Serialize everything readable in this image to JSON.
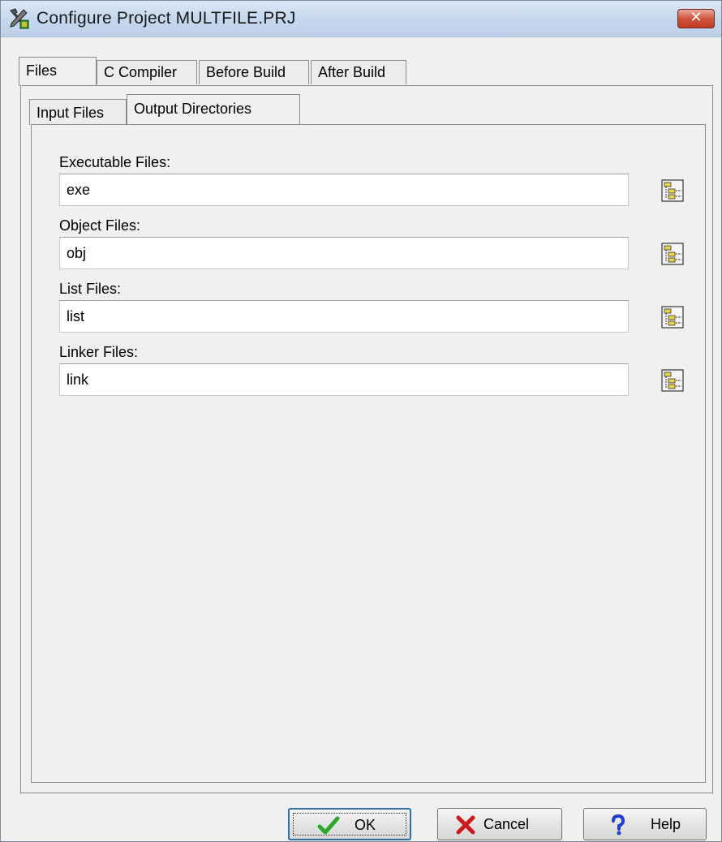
{
  "window": {
    "title": "Configure Project MULTFILE.PRJ"
  },
  "tabs": [
    {
      "label": "Files"
    },
    {
      "label": "C Compiler"
    },
    {
      "label": "Before Build"
    },
    {
      "label": "After Build"
    }
  ],
  "subtabs": [
    {
      "label": "Input Files"
    },
    {
      "label": "Output Directories"
    }
  ],
  "fields": [
    {
      "label": "Executable Files:",
      "value": "exe",
      "browse_icon": "folder-tree-icon"
    },
    {
      "label": "Object Files:",
      "value": "obj",
      "browse_icon": "folder-tree-icon"
    },
    {
      "label": "List Files:",
      "value": "list",
      "browse_icon": "folder-tree-icon"
    },
    {
      "label": "Linker Files:",
      "value": "link",
      "browse_icon": "folder-tree-icon"
    }
  ],
  "buttons": {
    "ok": {
      "label": "OK",
      "icon": "checkmark-icon"
    },
    "cancel": {
      "label": "Cancel",
      "icon": "x-icon"
    },
    "help": {
      "label": "Help",
      "icon": "question-icon"
    }
  },
  "colors": {
    "ok_icon": "#2aa82a",
    "cancel_icon": "#cc1a1a",
    "help_icon": "#1f3fcc",
    "close_button": "#c8472e"
  }
}
